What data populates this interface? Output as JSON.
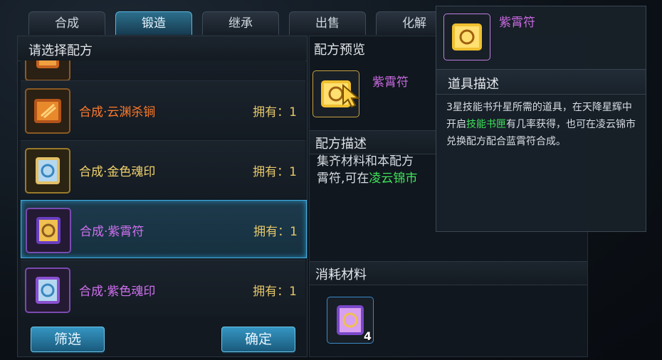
{
  "tabs": [
    {
      "label": "合成",
      "active": false
    },
    {
      "label": "锻造",
      "active": true
    },
    {
      "label": "继承",
      "active": false
    },
    {
      "label": "出售",
      "active": false
    },
    {
      "label": "化解",
      "active": false
    }
  ],
  "left": {
    "header": "请选择配方",
    "recipes": [
      {
        "name": "合成·云渊杀锏",
        "owned": "拥有：1",
        "color": "#ff7a2a",
        "icon": "scroll-orange-icon"
      },
      {
        "name": "合成·金色魂印",
        "owned": "拥有：1",
        "color": "#f2d36a",
        "icon": "talisman-gold-icon"
      },
      {
        "name": "合成·紫霄符",
        "owned": "拥有：1",
        "color": "#d070f0",
        "icon": "scroll-purple-icon",
        "selected": true
      },
      {
        "name": "合成·紫色魂印",
        "owned": "拥有：1",
        "color": "#d070f0",
        "icon": "talisman-purple-icon"
      }
    ],
    "filter_button": "筛选",
    "confirm_button": "确定"
  },
  "mid": {
    "preview_title": "配方预览",
    "preview_item_name": "紫霄符",
    "desc_title": "配方描述",
    "desc_line1": "集齐材料和本配方",
    "desc_line2_a": "霄符,可在",
    "desc_line2_b": "凌云锦市",
    "materials_title": "消耗材料",
    "material_count": "4"
  },
  "tooltip": {
    "item_name": "紫霄符",
    "section_title": "道具描述",
    "text_a": "3星技能书升星所需的道具，在天降星辉中开启",
    "text_highlight": "技能书匣",
    "text_b": "有几率获得，也可在凌云锦市兑换配方配合蓝霄符合成。"
  },
  "colors": {
    "accent": "#3fb0e0",
    "purple": "#d070f0",
    "gold": "#e4c66a",
    "green": "#3fe35a"
  }
}
